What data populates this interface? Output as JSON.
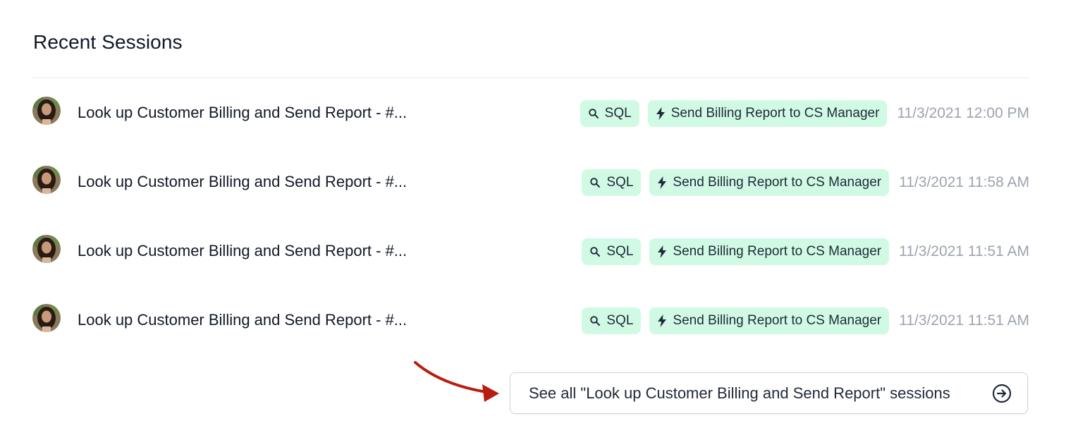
{
  "section": {
    "title": "Recent Sessions"
  },
  "sessions": [
    {
      "title": "Look up Customer Billing and Send Report - #...",
      "tags": [
        {
          "icon": "search-icon",
          "label": "SQL"
        },
        {
          "icon": "lightning-icon",
          "label": "Send Billing Report to CS Manager"
        }
      ],
      "timestamp": "11/3/2021 12:00 PM"
    },
    {
      "title": "Look up Customer Billing and Send Report - #...",
      "tags": [
        {
          "icon": "search-icon",
          "label": "SQL"
        },
        {
          "icon": "lightning-icon",
          "label": "Send Billing Report to CS Manager"
        }
      ],
      "timestamp": "11/3/2021 11:58 AM"
    },
    {
      "title": "Look up Customer Billing and Send Report - #...",
      "tags": [
        {
          "icon": "search-icon",
          "label": "SQL"
        },
        {
          "icon": "lightning-icon",
          "label": "Send Billing Report to CS Manager"
        }
      ],
      "timestamp": "11/3/2021 11:51 AM"
    },
    {
      "title": "Look up Customer Billing and Send Report - #...",
      "tags": [
        {
          "icon": "search-icon",
          "label": "SQL"
        },
        {
          "icon": "lightning-icon",
          "label": "Send Billing Report to CS Manager"
        }
      ],
      "timestamp": "11/3/2021 11:51 AM"
    }
  ],
  "see_all": {
    "label": "See all \"Look up Customer Billing and Send Report\" sessions",
    "icon": "arrow-right-circle-icon"
  },
  "colors": {
    "tag_bg": "#d1fae5",
    "timestamp": "#9ca3af",
    "annotation_arrow": "#b91c10"
  }
}
